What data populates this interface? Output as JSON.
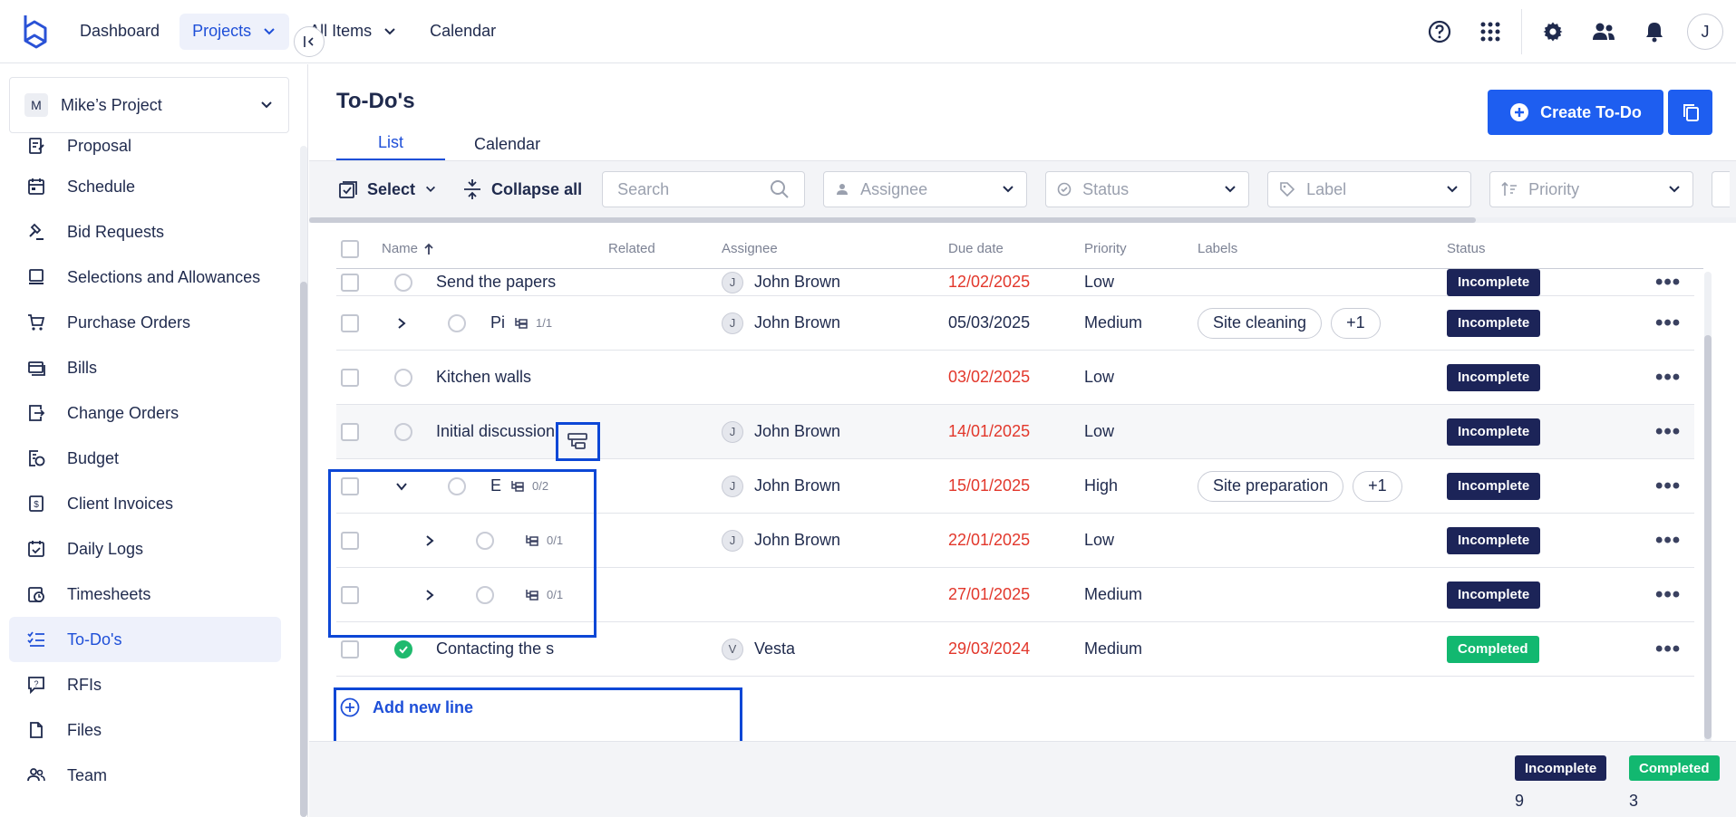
{
  "topnav": {
    "dashboard": "Dashboard",
    "projects": "Projects",
    "all_items": "All Items",
    "calendar": "Calendar",
    "user_initial": "J"
  },
  "sidebar": {
    "project_initial": "M",
    "project_name": "Mike’s Project",
    "items": [
      {
        "label": "Proposal",
        "icon": "proposal-icon"
      },
      {
        "label": "Schedule",
        "icon": "calendar-icon"
      },
      {
        "label": "Bid Requests",
        "icon": "gavel-icon"
      },
      {
        "label": "Selections and Allowances",
        "icon": "selections-icon"
      },
      {
        "label": "Purchase Orders",
        "icon": "cart-icon"
      },
      {
        "label": "Bills",
        "icon": "bills-icon"
      },
      {
        "label": "Change Orders",
        "icon": "change-orders-icon"
      },
      {
        "label": "Budget",
        "icon": "budget-icon"
      },
      {
        "label": "Client Invoices",
        "icon": "invoice-icon"
      },
      {
        "label": "Daily Logs",
        "icon": "daily-log-icon"
      },
      {
        "label": "Timesheets",
        "icon": "timesheet-icon"
      },
      {
        "label": "To-Do's",
        "icon": "todo-icon"
      },
      {
        "label": "RFIs",
        "icon": "rfi-icon"
      },
      {
        "label": "Files",
        "icon": "file-icon"
      },
      {
        "label": "Team",
        "icon": "team-icon"
      }
    ]
  },
  "page": {
    "title": "To-Do's",
    "tabs": [
      "List",
      "Calendar"
    ],
    "create_label": "Create To-Do"
  },
  "toolbar": {
    "select_label": "Select",
    "collapse_label": "Collapse all",
    "search_placeholder": "Search",
    "filters": [
      "Assignee",
      "Status",
      "Label",
      "Priority"
    ]
  },
  "table": {
    "headers": [
      "Name",
      "Related",
      "Assignee",
      "Due date",
      "Priority",
      "Labels",
      "Status"
    ],
    "rows": [
      {
        "name": "Send the papers",
        "assignee_initial": "J",
        "assignee": "John Brown",
        "due": "12/02/2025",
        "priority": "Low",
        "labels": [],
        "status": "Incomplete"
      },
      {
        "name": "Pi",
        "subtasks": "1/1",
        "assignee_initial": "J",
        "assignee": "John Brown",
        "due": "05/03/2025",
        "priority": "Medium",
        "labels": [
          "Site cleaning",
          "+1"
        ],
        "status": "Incomplete"
      },
      {
        "name": "Kitchen walls",
        "assignee_initial": "",
        "assignee": "",
        "due": "03/02/2025",
        "priority": "Low",
        "labels": [],
        "status": "Incomplete"
      },
      {
        "name": "Initial discussion",
        "assignee_initial": "J",
        "assignee": "John Brown",
        "due": "14/01/2025",
        "priority": "Low",
        "labels": [],
        "status": "Incomplete"
      },
      {
        "name": "E",
        "subtasks": "0/2",
        "assignee_initial": "J",
        "assignee": "John Brown",
        "due": "15/01/2025",
        "priority": "High",
        "labels": [
          "Site preparation",
          "+1"
        ],
        "status": "Incomplete"
      },
      {
        "name": "",
        "subtasks": "0/1",
        "assignee_initial": "J",
        "assignee": "John Brown",
        "due": "22/01/2025",
        "priority": "Low",
        "labels": [],
        "status": "Incomplete"
      },
      {
        "name": "",
        "subtasks": "0/1",
        "assignee_initial": "",
        "assignee": "",
        "due": "27/01/2025",
        "priority": "Medium",
        "labels": [],
        "status": "Incomplete"
      },
      {
        "name": "Contacting the s",
        "assignee_initial": "V",
        "assignee": "Vesta",
        "due": "29/03/2024",
        "priority": "Medium",
        "labels": [],
        "status": "Completed"
      }
    ],
    "add_line_label": "Add new line"
  },
  "summary": {
    "incomplete_label": "Incomplete",
    "incomplete_count": "9",
    "completed_label": "Completed",
    "completed_count": "3"
  },
  "colors": {
    "accent": "#1e5ef0",
    "incomplete": "#1c2458",
    "completed": "#12b870",
    "overdue": "#e2372b",
    "highlight": "#0d47d6"
  }
}
